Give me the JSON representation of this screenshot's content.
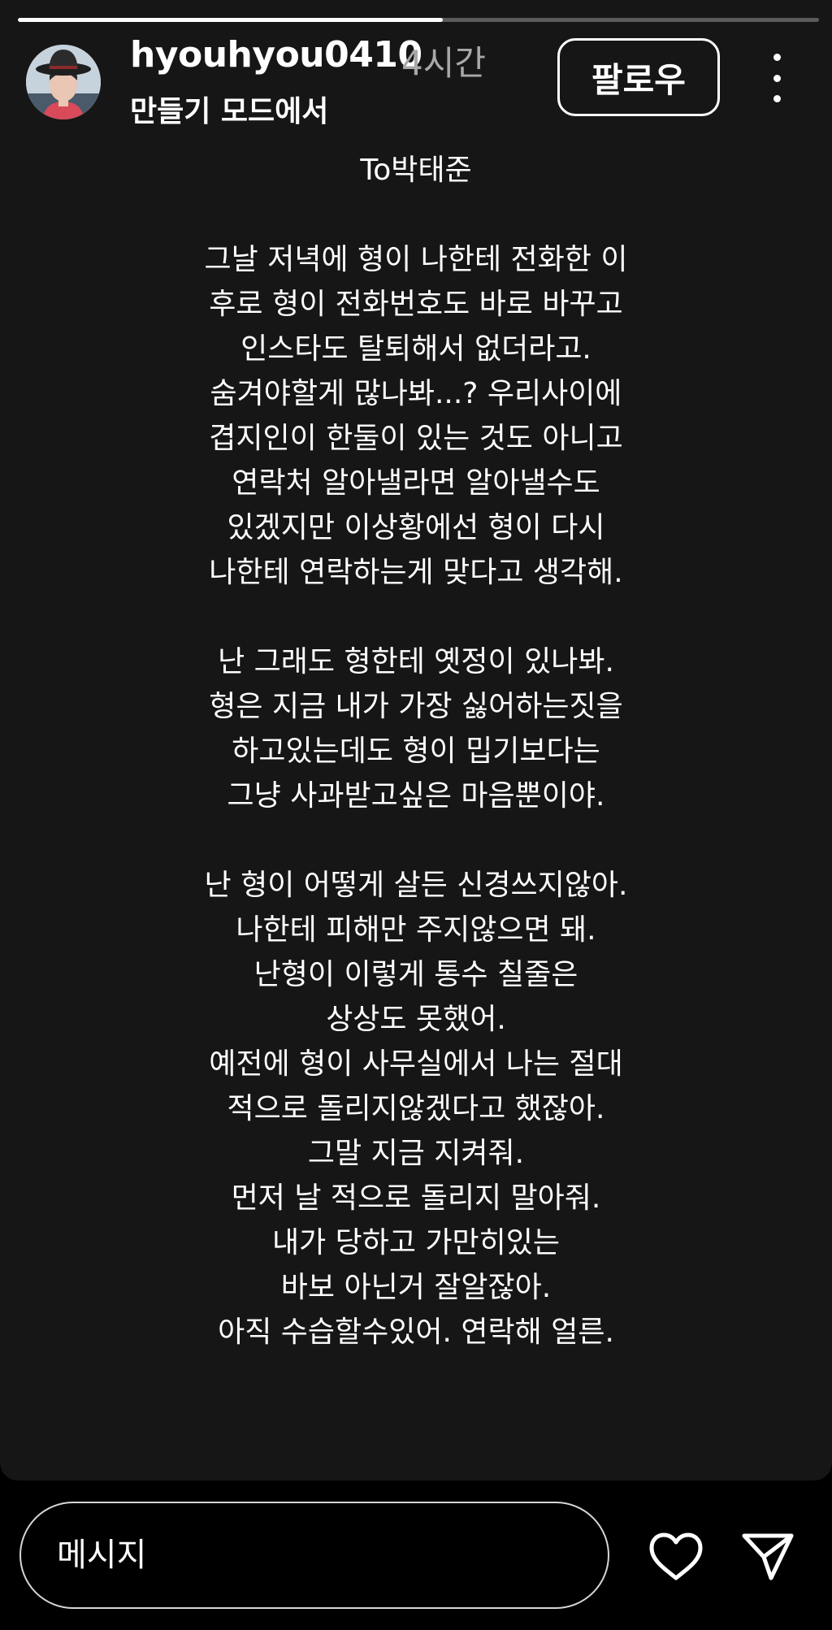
{
  "story": {
    "progress": 0.53
  },
  "header": {
    "username": "hyouhyou0410",
    "time": "4시간",
    "subtitle": "만들기 모드에서",
    "follow_label": "팔로우",
    "avatar_icon": "profile-photo",
    "more_icon": "more-vertical-icon"
  },
  "story_text": {
    "lines": [
      "To박태준",
      "",
      "그날 저녁에 형이 나한테 전화한 이",
      "후로 형이 전화번호도 바로 바꾸고",
      "인스타도 탈퇴해서 없더라고.",
      "숨겨야할게 많나봐...? 우리사이에",
      "겹지인이 한둘이 있는 것도 아니고",
      "연락처 알아낼라면 알아낼수도",
      "있겠지만 이상황에선 형이 다시",
      "나한테 연락하는게 맞다고 생각해.",
      "",
      "난 그래도 형한테 옛정이 있나봐.",
      "형은 지금 내가 가장 싫어하는짓을",
      "하고있는데도 형이 밉기보다는",
      "그냥 사과받고싶은 마음뿐이야.",
      "",
      "난 형이 어떻게 살든 신경쓰지않아.",
      "나한테 피해만 주지않으면 돼.",
      "난형이 이렇게 통수 칠줄은",
      "상상도 못했어.",
      "예전에 형이 사무실에서 나는 절대",
      "적으로 돌리지않겠다고 했잖아.",
      "그말 지금 지켜줘.",
      "먼저 날 적으로 돌리지 말아줘.",
      "내가 당하고 가만히있는",
      "바보 아닌거 잘알잖아.",
      "아직 수습할수있어. 연락해 얼른."
    ]
  },
  "footer": {
    "message_placeholder": "메시지",
    "like_icon": "heart-icon",
    "share_icon": "send-icon"
  },
  "colors": {
    "background": "#000000",
    "story_background": "#161616",
    "text": "#ffffff",
    "secondary_text": "#a8a8a8",
    "progress_track": "#5b5b5b"
  }
}
